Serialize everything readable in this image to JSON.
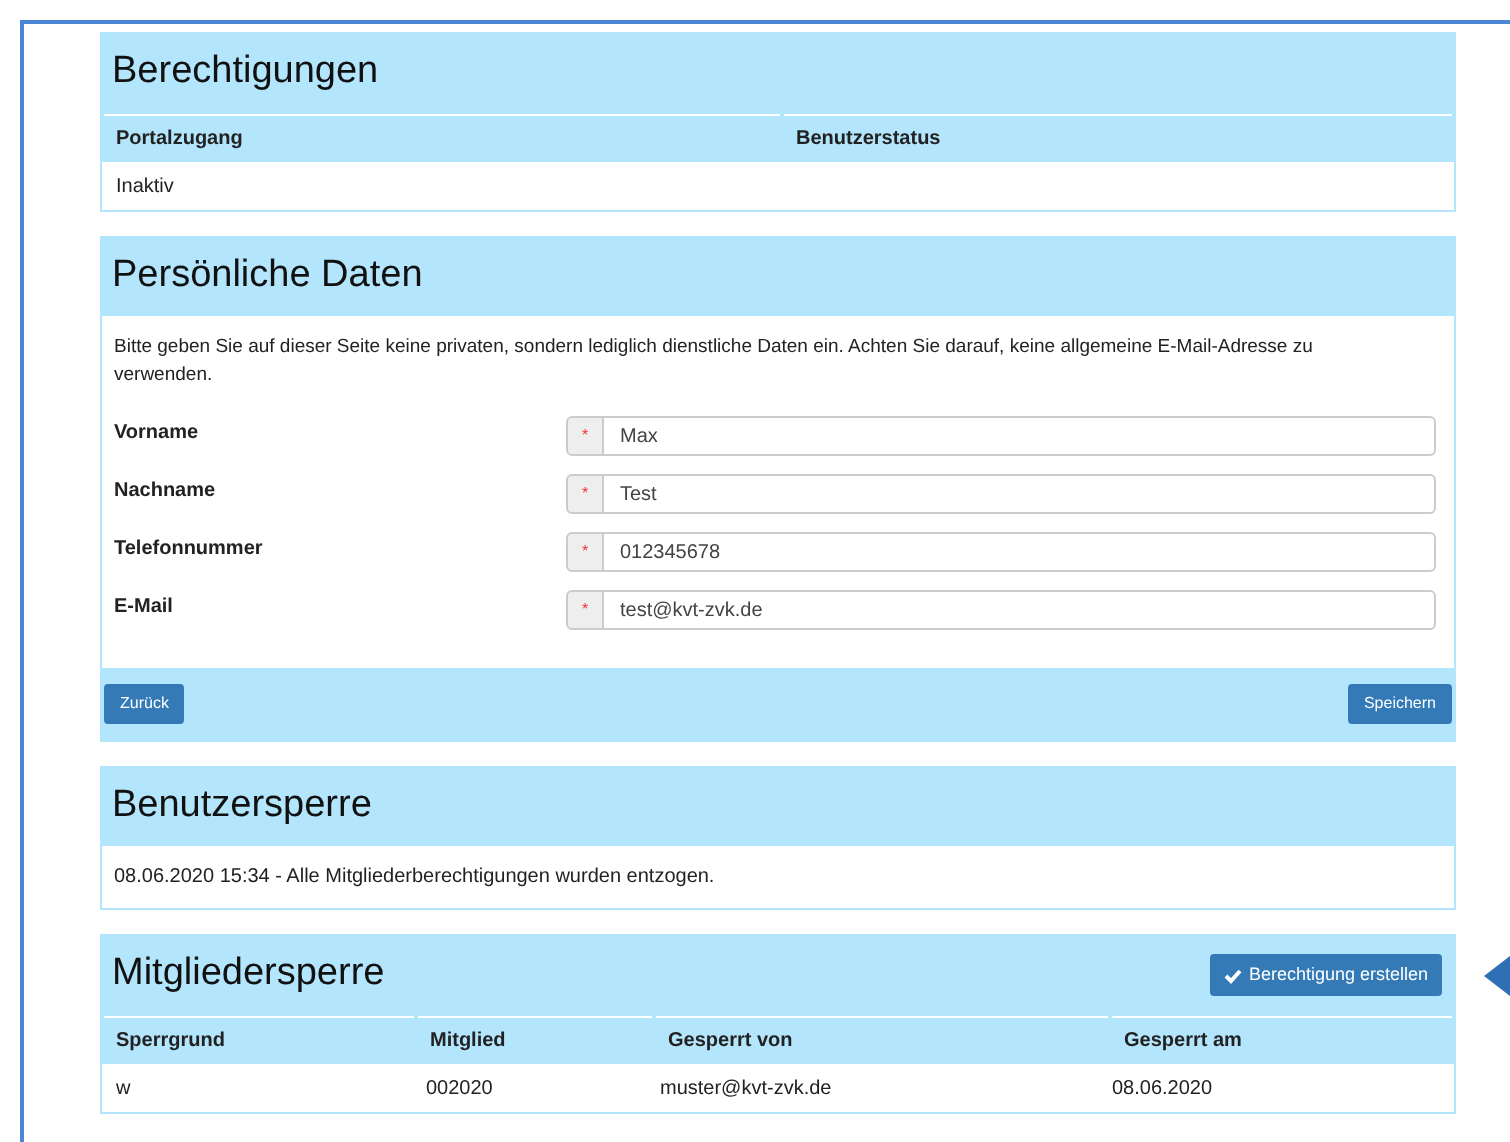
{
  "berechtigungen": {
    "title": "Berechtigungen",
    "columns": [
      "Portalzugang",
      "Benutzerstatus"
    ],
    "rows": [
      [
        "Inaktiv",
        ""
      ]
    ]
  },
  "persoenliche_daten": {
    "title": "Persönliche Daten",
    "hint": "Bitte geben Sie auf dieser Seite keine privaten, sondern lediglich dienstliche Daten ein. Achten Sie darauf, keine allgemeine E-Mail-Adresse zu verwenden.",
    "fields": [
      {
        "label": "Vorname",
        "value": "Max",
        "required_mark": "*"
      },
      {
        "label": "Nachname",
        "value": "Test",
        "required_mark": "*"
      },
      {
        "label": "Telefonnummer",
        "value": "012345678",
        "required_mark": "*"
      },
      {
        "label": "E-Mail",
        "value": "test@kvt-zvk.de",
        "required_mark": "*"
      }
    ],
    "buttons": [
      "Zurück",
      "Speichern"
    ]
  },
  "benutzersperre": {
    "title": "Benutzersperre",
    "text": "08.06.2020 15:34 - Alle Mitgliederberechtigungen wurden entzogen."
  },
  "mitgliedersperre": {
    "title": "Mitgliedersperre",
    "button": "Berechtigung erstellen",
    "columns": [
      "Sperrgrund",
      "Mitglied",
      "Gesperrt von",
      "Gesperrt am"
    ],
    "rows": [
      [
        "w",
        "002020",
        "muster@kvt-zvk.de",
        "08.06.2020"
      ]
    ]
  }
}
